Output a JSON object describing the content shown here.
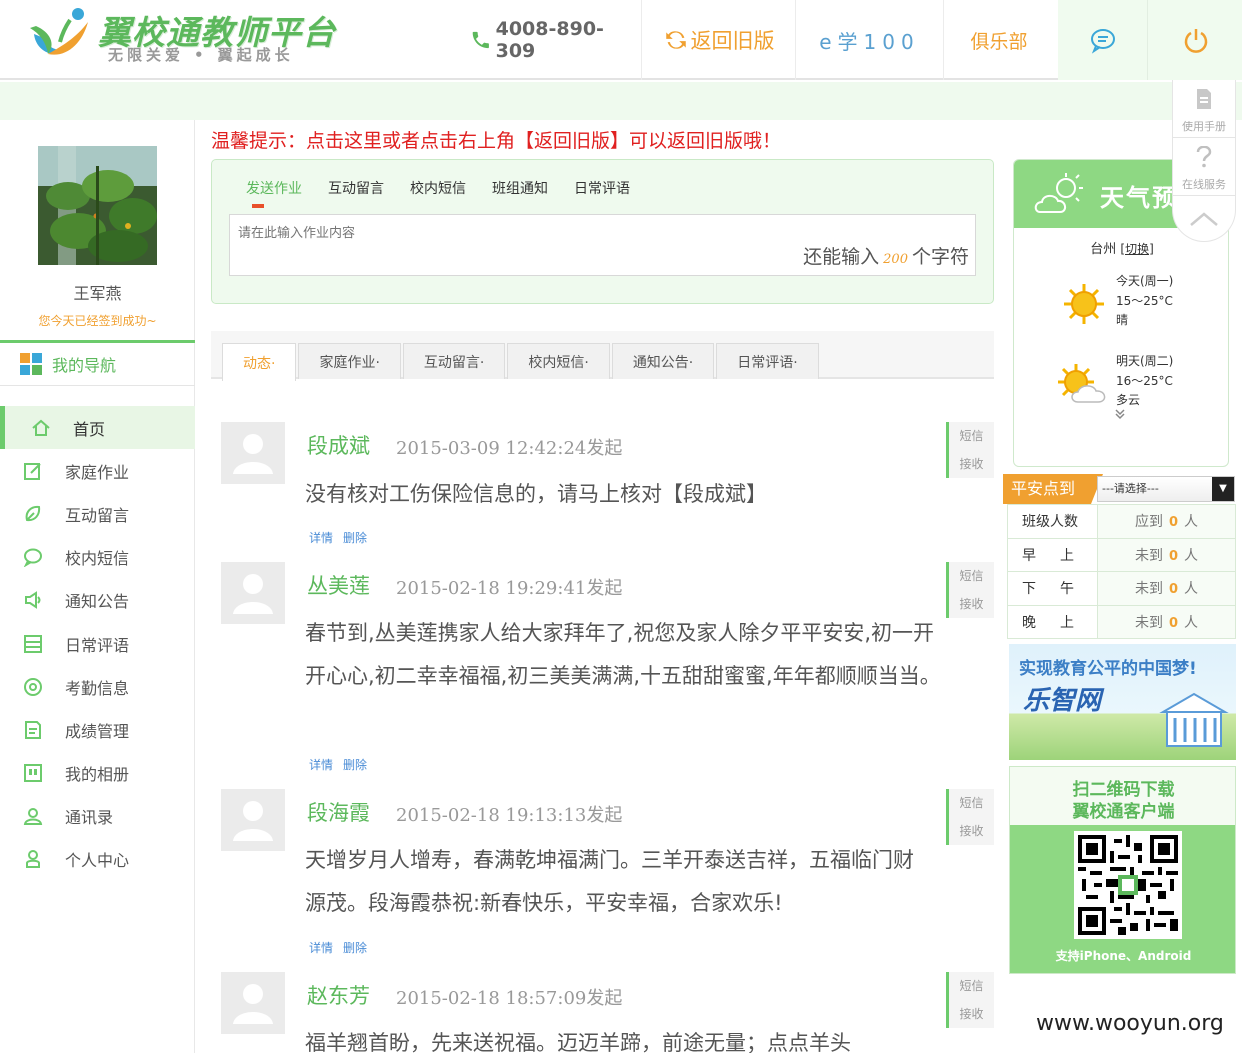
{
  "header": {
    "logo_title": "翼校通教师平台",
    "logo_slogan_left": "无限关爱",
    "logo_slogan_sep": "•",
    "logo_slogan_right": "翼起成长",
    "phone": "4008-890-309",
    "old_version": "返回旧版",
    "elearn": "e学100",
    "club": "俱乐部",
    "icons": {
      "phone": "phone-icon",
      "refresh": "refresh-icon",
      "message": "chat-bubble-icon",
      "power": "power-icon"
    }
  },
  "sidebar": {
    "user_name": "王军燕",
    "sign_status": "您今天已经签到成功~",
    "nav_title": "我的导航",
    "items": [
      {
        "label": "首页",
        "icon": "home-icon",
        "active": true
      },
      {
        "label": "家庭作业",
        "icon": "edit-icon"
      },
      {
        "label": "互动留言",
        "icon": "leaf-icon"
      },
      {
        "label": "校内短信",
        "icon": "speech-bubble-icon"
      },
      {
        "label": "通知公告",
        "icon": "speaker-icon"
      },
      {
        "label": "日常评语",
        "icon": "list-icon"
      },
      {
        "label": "考勤信息",
        "icon": "clock-icon"
      },
      {
        "label": "成绩管理",
        "icon": "report-icon"
      },
      {
        "label": "我的相册",
        "icon": "album-icon"
      },
      {
        "label": "通讯录",
        "icon": "contacts-icon"
      },
      {
        "label": "个人中心",
        "icon": "user-icon"
      }
    ]
  },
  "tip": "温馨提示：点击这里或者点击右上角【返回旧版】可以返回旧版哦！",
  "compose": {
    "tabs": [
      "发送作业",
      "互动留言",
      "校内短信",
      "班组通知",
      "日常评语"
    ],
    "placeholder": "请在此输入作业内容",
    "count_prefix": "还能输入",
    "count_value": "200",
    "count_suffix": "个字符"
  },
  "feed_tabs": [
    "动态·",
    "家庭作业·",
    "互动留言·",
    "校内短信·",
    "通知公告·",
    "日常评语·"
  ],
  "posts": [
    {
      "author": "段成斌",
      "time": "2015-03-09 12:42:24发起",
      "body": "没有核对工伤保险信息的，请马上核对【段成斌】",
      "detail": "详情",
      "delete": "删除",
      "sms": "短信",
      "receive": "接收"
    },
    {
      "author": "丛美莲",
      "time": "2015-02-18 19:29:41发起",
      "body": "春节到,丛美莲携家人给大家拜年了,祝您及家人除夕平平安安,初一开开心心,初二幸幸福福,初三美美满满,十五甜甜蜜蜜,年年都顺顺当当。",
      "detail": "详情",
      "delete": "删除",
      "sms": "短信",
      "receive": "接收"
    },
    {
      "author": "段海霞",
      "time": "2015-02-18 19:13:13发起",
      "body": "天增岁月人增寿，春满乾坤福满门。三羊开泰送吉祥，五福临门财源茂。段海霞恭祝:新春快乐，平安幸福，合家欢乐!",
      "detail": "详情",
      "delete": "删除",
      "sms": "短信",
      "receive": "接收"
    },
    {
      "author": "赵东芳",
      "time": "2015-02-18 18:57:09发起",
      "body": "福羊翘首盼，先来送祝福。迈迈羊蹄，前途无量；点点羊头",
      "detail": "详情",
      "delete": "删除",
      "sms": "短信",
      "receive": "接收"
    }
  ],
  "weather": {
    "title": "天气预报",
    "city": "台州",
    "switch": "[切换]",
    "days": [
      {
        "day": "今天(周一)",
        "temp": "15～25°C",
        "desc": "晴",
        "icon": "sun-icon"
      },
      {
        "day": "明天(周二)",
        "temp": "16～25°C",
        "desc": "多云",
        "icon": "sun-cloud-icon"
      }
    ]
  },
  "sidetools": {
    "manual": "使用手册",
    "service": "在线服务"
  },
  "checkin": {
    "title": "平安点到",
    "select": "---请选择---",
    "rows": [
      {
        "label": "班级人数",
        "status": "应到",
        "count": "0",
        "unit": "人"
      },
      {
        "label_a": "早",
        "label_b": "上",
        "status": "未到",
        "count": "0",
        "unit": "人"
      },
      {
        "label_a": "下",
        "label_b": "午",
        "status": "未到",
        "count": "0",
        "unit": "人"
      },
      {
        "label_a": "晚",
        "label_b": "上",
        "status": "未到",
        "count": "0",
        "unit": "人"
      }
    ]
  },
  "ads": {
    "lezhi_slogan": "实现教育公平的中国梦!",
    "lezhi_name": "乐智网",
    "qr_title1": "扫二维码下载",
    "qr_title2": "翼校通客户端",
    "qr_support": "支持iPhone、Android"
  },
  "watermark": "www.wooyun.org",
  "colors": {
    "brand_green": "#5cb85c",
    "accent_orange": "#f0a030",
    "tip_red": "#e02020",
    "light_green_bg": "#effaee"
  }
}
